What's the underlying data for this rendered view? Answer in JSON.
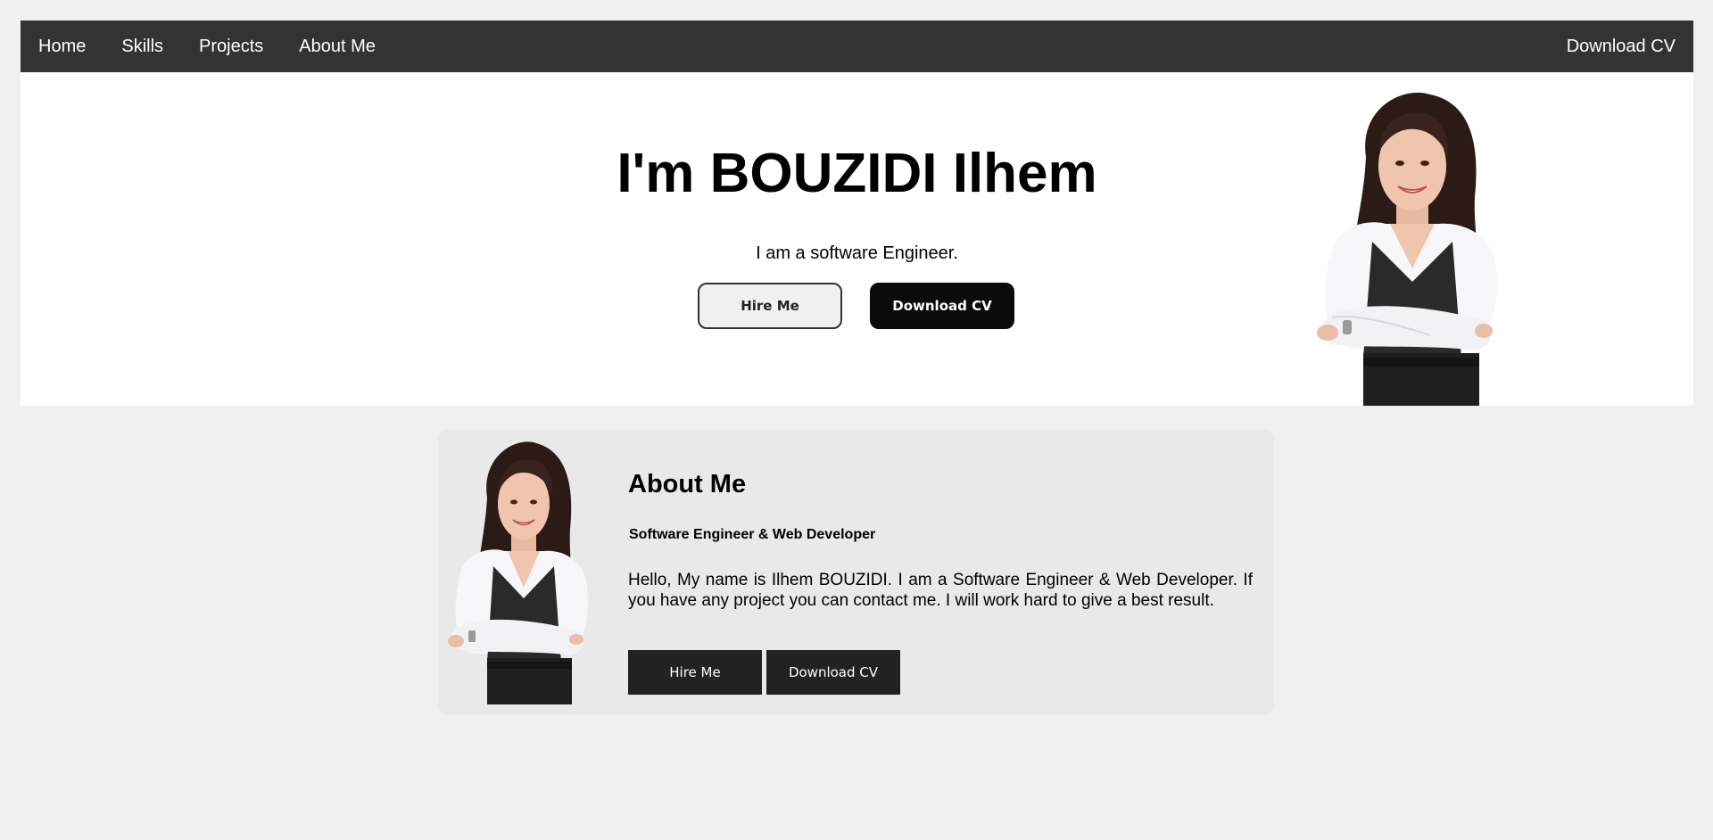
{
  "nav": {
    "items": [
      {
        "label": "Home"
      },
      {
        "label": "Skills"
      },
      {
        "label": "Projects"
      },
      {
        "label": "About Me"
      }
    ],
    "download_cv": "Download CV"
  },
  "hero": {
    "title": "I'm BOUZIDI Ilhem",
    "subtitle": "I am a software Engineer.",
    "hire_label": "Hire Me",
    "download_label": "Download CV"
  },
  "about": {
    "title": "About Me",
    "role": "Software Engineer & Web Developer",
    "text": "Hello, My name is Ilhem BOUZIDI. I am a Software Engineer & Web Developer. If you have any project you can contact me. I will work hard to give a best result.",
    "hire_label": "Hire Me",
    "download_label": "Download CV"
  },
  "colors": {
    "nav_bg": "#333333",
    "page_bg": "#f0f0f0",
    "card_bg": "#e9e9e9",
    "button_dark": "#222222"
  }
}
